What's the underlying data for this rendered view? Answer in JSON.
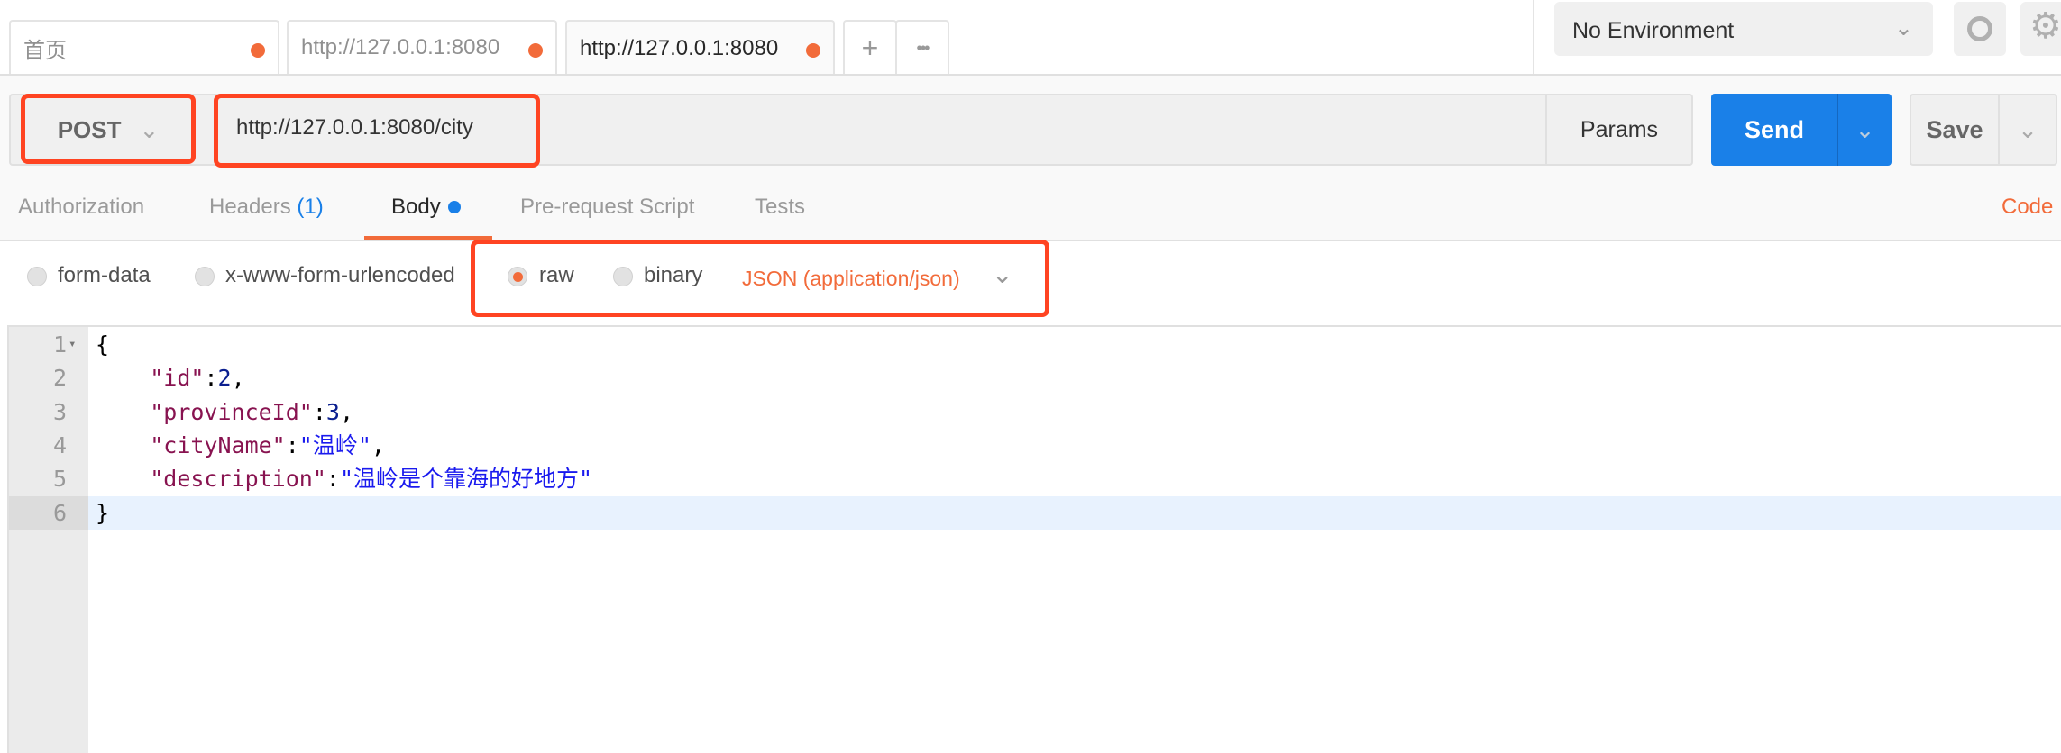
{
  "tabs": [
    {
      "label": "首页",
      "unsaved": true
    },
    {
      "label": "http://127.0.0.1:8080",
      "unsaved": true
    },
    {
      "label": "http://127.0.0.1:8080",
      "unsaved": true,
      "active": true
    }
  ],
  "tab_actions": {
    "add": "+",
    "more": "•••"
  },
  "environment": {
    "selected": "No Environment"
  },
  "request": {
    "method": "POST",
    "url": "http://127.0.0.1:8080/city",
    "params_label": "Params",
    "send_label": "Send",
    "save_label": "Save"
  },
  "subtabs": [
    {
      "label": "Authorization"
    },
    {
      "label": "Headers",
      "count": "(1)"
    },
    {
      "label": "Body",
      "active": true
    },
    {
      "label": "Pre-request Script"
    },
    {
      "label": "Tests"
    }
  ],
  "code_link": "Code",
  "body_types": [
    {
      "label": "form-data"
    },
    {
      "label": "x-www-form-urlencoded"
    },
    {
      "label": "raw",
      "selected": true
    },
    {
      "label": "binary"
    }
  ],
  "content_type": "JSON (application/json)",
  "editor": {
    "lines": [
      {
        "n": "1",
        "parts": [
          [
            "p",
            "{"
          ]
        ]
      },
      {
        "n": "2",
        "parts": [
          [
            "p",
            "    "
          ],
          [
            "k",
            "\"id\""
          ],
          [
            "p",
            ":"
          ],
          [
            "n",
            "2"
          ],
          [
            "p",
            ","
          ]
        ]
      },
      {
        "n": "3",
        "parts": [
          [
            "p",
            "    "
          ],
          [
            "k",
            "\"provinceId\""
          ],
          [
            "p",
            ":"
          ],
          [
            "n",
            "3"
          ],
          [
            "p",
            ","
          ]
        ]
      },
      {
        "n": "4",
        "parts": [
          [
            "p",
            "    "
          ],
          [
            "k",
            "\"cityName\""
          ],
          [
            "p",
            ":"
          ],
          [
            "s",
            "\"温岭\""
          ],
          [
            "p",
            ","
          ]
        ]
      },
      {
        "n": "5",
        "parts": [
          [
            "p",
            "    "
          ],
          [
            "k",
            "\"description\""
          ],
          [
            "p",
            ":"
          ],
          [
            "s",
            "\"温岭是个靠海的好地方\""
          ]
        ]
      },
      {
        "n": "6",
        "parts": [
          [
            "p",
            "}"
          ]
        ]
      }
    ],
    "active_line": 6
  },
  "colors": {
    "accent": "#f26b3a",
    "send": "#1a80e8",
    "highlight": "#ff4422",
    "key": "#881350",
    "string": "#1a1aee"
  }
}
